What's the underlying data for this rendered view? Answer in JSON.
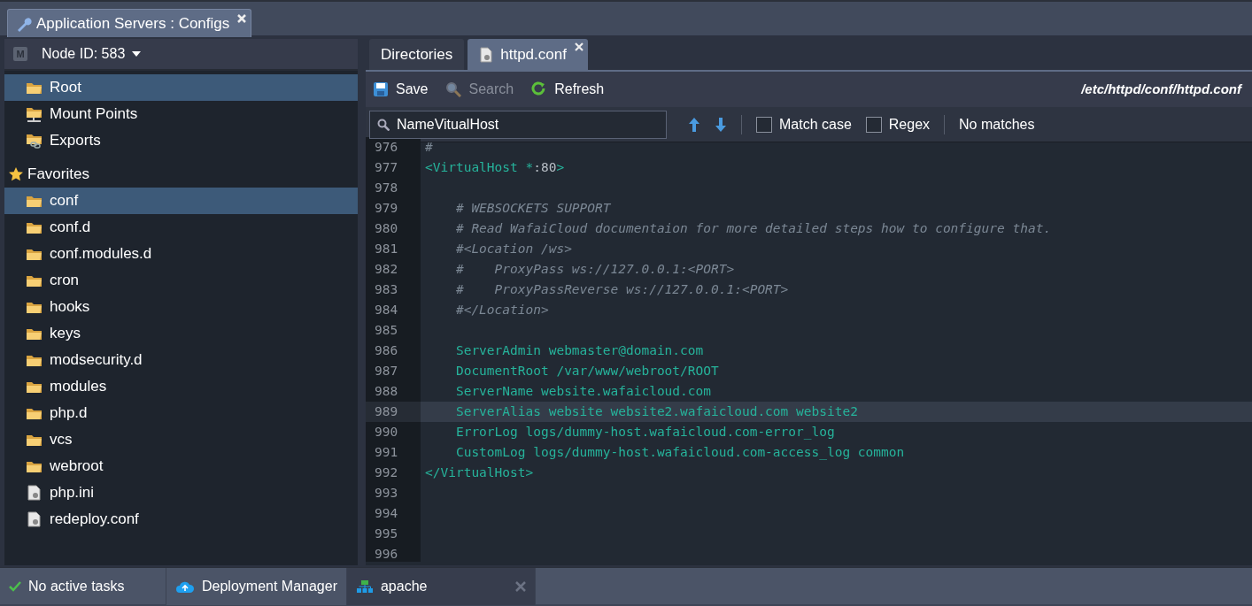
{
  "window_tab": {
    "title": "Application Servers : Configs"
  },
  "node_selector": {
    "badge": "M",
    "label": "Node ID: 583"
  },
  "locations": [
    {
      "label": "Root",
      "kind": "folder",
      "selected": true
    },
    {
      "label": "Mount Points",
      "kind": "mount",
      "selected": false
    },
    {
      "label": "Exports",
      "kind": "export",
      "selected": false
    }
  ],
  "favorites": {
    "label": "Favorites",
    "items": [
      {
        "label": "conf",
        "kind": "folder",
        "selected": true
      },
      {
        "label": "conf.d",
        "kind": "folder",
        "selected": false
      },
      {
        "label": "conf.modules.d",
        "kind": "folder",
        "selected": false
      },
      {
        "label": "cron",
        "kind": "folder",
        "selected": false
      },
      {
        "label": "hooks",
        "kind": "folder",
        "selected": false
      },
      {
        "label": "keys",
        "kind": "folder",
        "selected": false
      },
      {
        "label": "modsecurity.d",
        "kind": "folder",
        "selected": false
      },
      {
        "label": "modules",
        "kind": "folder",
        "selected": false
      },
      {
        "label": "php.d",
        "kind": "folder",
        "selected": false
      },
      {
        "label": "vcs",
        "kind": "folder",
        "selected": false
      },
      {
        "label": "webroot",
        "kind": "folder",
        "selected": false
      },
      {
        "label": "php.ini",
        "kind": "file",
        "selected": false
      },
      {
        "label": "redeploy.conf",
        "kind": "file",
        "selected": false
      }
    ]
  },
  "editor_tabs": [
    {
      "label": "Directories",
      "kind": "plain",
      "selected": false,
      "closable": false
    },
    {
      "label": "httpd.conf",
      "kind": "file",
      "selected": true,
      "closable": true
    }
  ],
  "toolbar": {
    "buttons": [
      {
        "label": "Save",
        "kind": "save",
        "disabled": false
      },
      {
        "label": "Search",
        "kind": "search",
        "disabled": true
      },
      {
        "label": "Refresh",
        "kind": "refresh",
        "disabled": false
      }
    ],
    "path": "/etc/httpd/conf/httpd.conf"
  },
  "find": {
    "value": "NameVitualHost",
    "options": [
      {
        "label": "Match case",
        "checked": false
      },
      {
        "label": "Regex",
        "checked": false
      }
    ],
    "status": "No matches"
  },
  "code_lines": [
    {
      "number": "976",
      "highlighted": false,
      "segments": [
        {
          "text": "#",
          "kind": "comment"
        }
      ]
    },
    {
      "number": "977",
      "highlighted": false,
      "segments": [
        {
          "text": "<VirtualHost *",
          "kind": "tag"
        },
        {
          "text": ":80",
          "kind": "plain"
        },
        {
          "text": ">",
          "kind": "tag"
        }
      ]
    },
    {
      "number": "978",
      "highlighted": false
    },
    {
      "number": "979",
      "highlighted": false,
      "segments": [
        {
          "text": "    # WEBSOCKETS SUPPORT",
          "kind": "comment"
        }
      ]
    },
    {
      "number": "980",
      "highlighted": false,
      "segments": [
        {
          "text": "    # Read WafaiCloud documentaion for more detailed steps how to configure that.",
          "kind": "comment"
        }
      ]
    },
    {
      "number": "981",
      "highlighted": false,
      "segments": [
        {
          "text": "    #<Location /ws>",
          "kind": "comment"
        }
      ]
    },
    {
      "number": "982",
      "highlighted": false,
      "segments": [
        {
          "text": "    #    ProxyPass ws://127.0.0.1:<PORT>",
          "kind": "comment"
        }
      ]
    },
    {
      "number": "983",
      "highlighted": false,
      "segments": [
        {
          "text": "    #    ProxyPassReverse ws://127.0.0.1:<PORT>",
          "kind": "comment"
        }
      ]
    },
    {
      "number": "984",
      "highlighted": false,
      "segments": [
        {
          "text": "    #</Location>",
          "kind": "comment"
        }
      ]
    },
    {
      "number": "985",
      "highlighted": false
    },
    {
      "number": "986",
      "highlighted": false,
      "segments": [
        {
          "text": "    ServerAdmin webmaster@domain.com",
          "kind": "directive"
        }
      ]
    },
    {
      "number": "987",
      "highlighted": false,
      "segments": [
        {
          "text": "    DocumentRoot /var/www/webroot/ROOT",
          "kind": "directive"
        }
      ]
    },
    {
      "number": "988",
      "highlighted": false,
      "segments": [
        {
          "text": "    ServerName website.wafaicloud.com",
          "kind": "directive"
        }
      ]
    },
    {
      "number": "989",
      "highlighted": true,
      "segments": [
        {
          "text": "    ServerAlias website website2.wafaicloud.com website2",
          "kind": "directive"
        }
      ]
    },
    {
      "number": "990",
      "highlighted": false,
      "segments": [
        {
          "text": "    ErrorLog logs/dummy-host.wafaicloud.com-error_log",
          "kind": "directive"
        }
      ]
    },
    {
      "number": "991",
      "highlighted": false,
      "segments": [
        {
          "text": "    CustomLog logs/dummy-host.wafaicloud.com-access_log common",
          "kind": "directive"
        }
      ]
    },
    {
      "number": "992",
      "highlighted": false,
      "segments": [
        {
          "text": "</VirtualHost>",
          "kind": "tag"
        }
      ]
    },
    {
      "number": "993",
      "highlighted": false
    },
    {
      "number": "994",
      "highlighted": false
    },
    {
      "number": "995",
      "highlighted": false
    },
    {
      "number": "996",
      "highlighted": false
    }
  ],
  "status_bar": {
    "tasks": "No active tasks",
    "tabs": [
      {
        "label": "Deployment Manager",
        "kind": "cloud",
        "selected": false,
        "closable": false
      },
      {
        "label": "apache",
        "kind": "nodes",
        "selected": true,
        "closable": true
      }
    ]
  }
}
